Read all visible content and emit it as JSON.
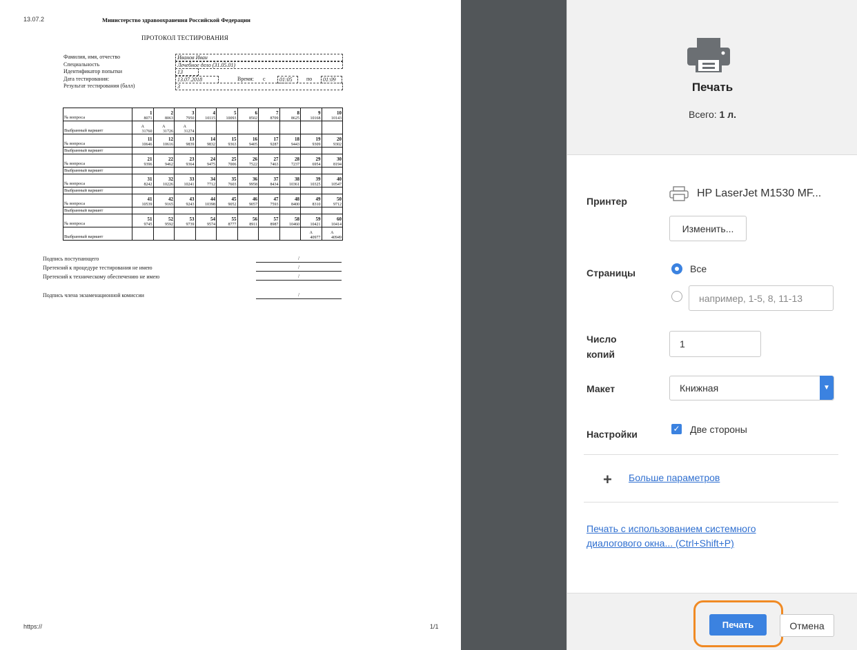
{
  "preview": {
    "header_date": "13.07.2",
    "footer_url": "https://",
    "footer_page": "1/1",
    "ministry": "Министерство здравоохранения Российской Федерации",
    "title": "ПРОТОКОЛ ТЕСТИРОВАНИЯ",
    "fields": {
      "name_label": "Фамилия, имя, отчество",
      "name_value": "Иванов Иван",
      "spec_label": "Специальность",
      "spec_value": "Лечебное дело (31.05.01)",
      "attempt_label": "Идентификатор попытки",
      "attempt_value": "13",
      "date_label": "Дата тестирования:",
      "date_value": "13.07.2018",
      "time_label": "Время:",
      "time_from_label": "с",
      "time_from": "01:05",
      "time_to_label": "по",
      "time_to": "01:09",
      "result_label": "Результат тестирования (балл)",
      "result_value": "3"
    },
    "q_label": "№ вопроса",
    "a_label": "Выбранный вариант",
    "blocks": [
      {
        "nums": [
          "1",
          "2",
          "3",
          "4",
          "5",
          "6",
          "7",
          "8",
          "9",
          "10"
        ],
        "ids": [
          "8071",
          "8063",
          "7950",
          "10115",
          "10093",
          "8502",
          "8709",
          "8625",
          "10168",
          "10143"
        ],
        "answers": [
          [
            "А",
            "31760"
          ],
          [
            "А",
            "31726"
          ],
          [
            "А",
            "31274"
          ],
          [
            "",
            ""
          ],
          [
            "",
            ""
          ],
          [
            "",
            ""
          ],
          [
            "",
            ""
          ],
          [
            "",
            ""
          ],
          [
            "",
            ""
          ],
          [
            "",
            ""
          ]
        ]
      },
      {
        "nums": [
          "11",
          "12",
          "13",
          "14",
          "15",
          "16",
          "17",
          "18",
          "19",
          "20"
        ],
        "ids": [
          "10646",
          "10616",
          "9839",
          "9832",
          "9363",
          "9405",
          "9287",
          "9443",
          "9309",
          "9302"
        ],
        "answers": null
      },
      {
        "nums": [
          "21",
          "22",
          "23",
          "24",
          "25",
          "26",
          "27",
          "28",
          "29",
          "30"
        ],
        "ids": [
          "9396",
          "9462",
          "9364",
          "9475",
          "7006",
          "7522",
          "7463",
          "7237",
          "6954",
          "8194"
        ],
        "answers": null
      },
      {
        "nums": [
          "31",
          "32",
          "33",
          "34",
          "35",
          "36",
          "37",
          "38",
          "39",
          "40"
        ],
        "ids": [
          "8242",
          "10226",
          "10241",
          "7712",
          "7603",
          "9958",
          "8434",
          "10361",
          "10325",
          "10547"
        ],
        "answers": null
      },
      {
        "nums": [
          "41",
          "42",
          "43",
          "44",
          "45",
          "46",
          "47",
          "48",
          "49",
          "50"
        ],
        "ids": [
          "10539",
          "9165",
          "9243",
          "10398",
          "9052",
          "9057",
          "7593",
          "8400",
          "8310",
          "9712"
        ],
        "answers": null
      },
      {
        "nums": [
          "51",
          "52",
          "53",
          "54",
          "55",
          "56",
          "57",
          "58",
          "59",
          "60"
        ],
        "ids": [
          "9745",
          "9592",
          "9739",
          "9574",
          "8777",
          "8911",
          "8987",
          "10460",
          "10421",
          "10414"
        ],
        "answers": [
          [
            "",
            ""
          ],
          [
            "",
            ""
          ],
          [
            "",
            ""
          ],
          [
            "",
            ""
          ],
          [
            "",
            ""
          ],
          [
            "",
            ""
          ],
          [
            "",
            ""
          ],
          [
            "",
            ""
          ],
          [
            "А",
            "40977"
          ],
          [
            "А",
            "40949"
          ]
        ]
      }
    ],
    "signatures": {
      "applicant": "Подпись поступающего",
      "procedure": "Претензий к процедуре тестирования не имею",
      "technical": "Претензий к техническому обеспечению не имею",
      "commission": "Подпись члена экзаменационной комиссии",
      "slash": "/"
    }
  },
  "dialog": {
    "title": "Печать",
    "total_prefix": "Всего:",
    "total_value": "1 л.",
    "printer_label": "Принтер",
    "printer_name": "HP LaserJet M1530 MF...",
    "change_button": "Изменить...",
    "pages_label": "Страницы",
    "pages_all": "Все",
    "pages_placeholder": "например, 1-5, 8, 11-13",
    "copies_label": "Число копий",
    "copies_value": "1",
    "layout_label": "Макет",
    "layout_value": "Книжная",
    "settings_label": "Настройки",
    "duplex_label": "Две стороны",
    "more_params": "Больше параметров",
    "system_dialog": "Печать с использованием системного диалогового окна... (Ctrl+Shift+P)",
    "print_button": "Печать",
    "cancel_button": "Отмена"
  },
  "colors": {
    "accent": "#3b82e0",
    "divider": "#525659",
    "highlight": "#f08a24",
    "link": "#2f6fd0"
  }
}
